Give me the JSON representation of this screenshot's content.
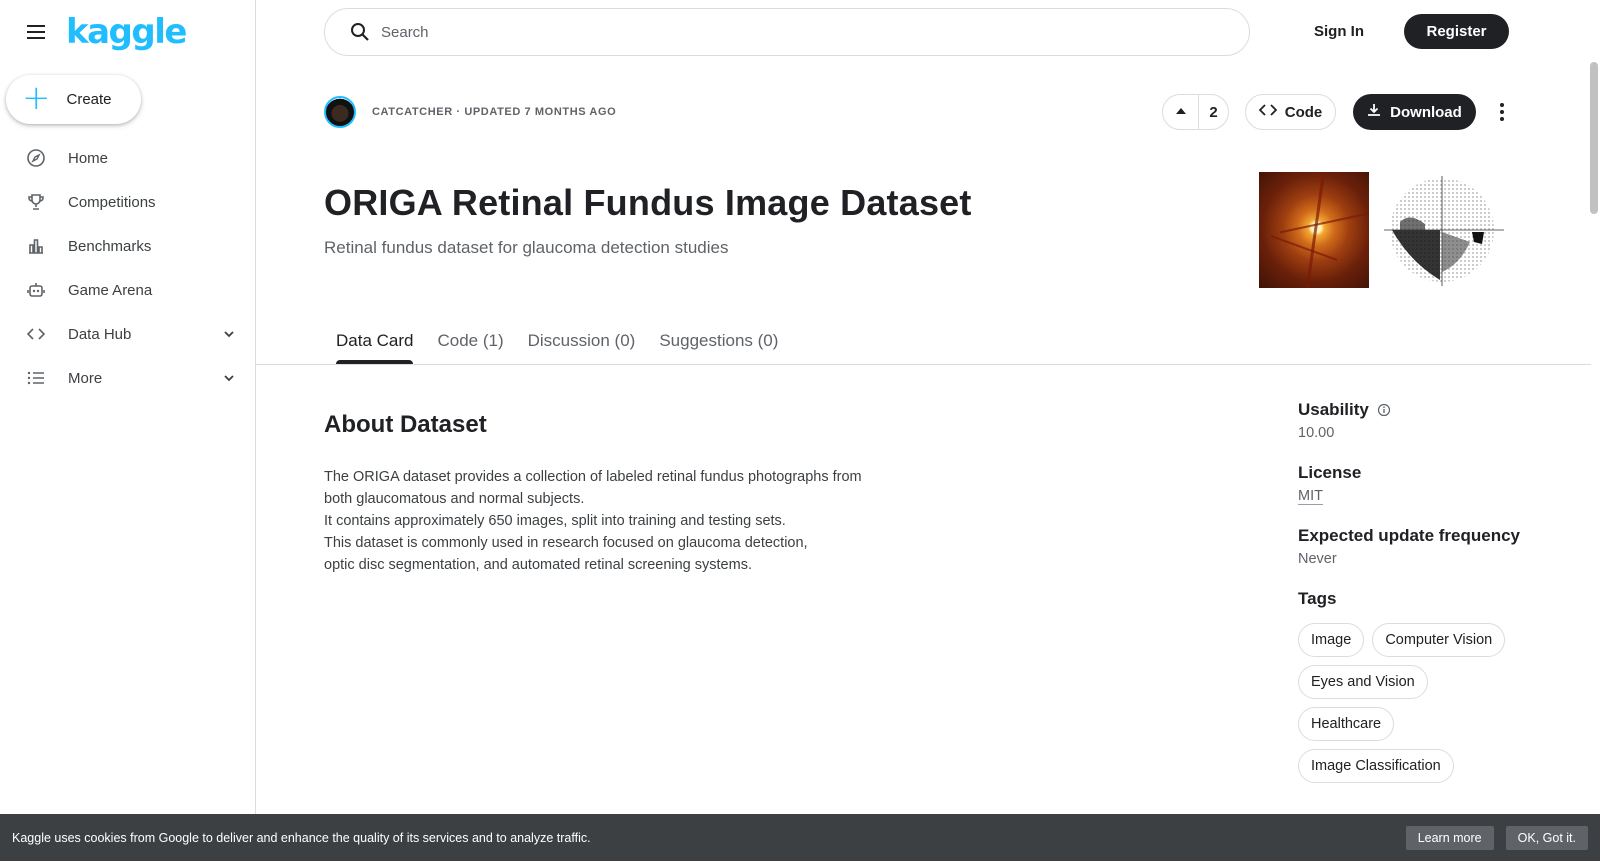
{
  "brand": {
    "logo_text": "kaggle",
    "accent": "#20beff"
  },
  "sidebar": {
    "create_label": "Create",
    "items": [
      {
        "label": "Home",
        "icon": "compass-icon"
      },
      {
        "label": "Competitions",
        "icon": "trophy-icon"
      },
      {
        "label": "Benchmarks",
        "icon": "bar-chart-icon"
      },
      {
        "label": "Game Arena",
        "icon": "robot-icon"
      },
      {
        "label": "Data Hub",
        "icon": "code-icon",
        "expandable": true
      },
      {
        "label": "More",
        "icon": "list-icon",
        "expandable": true
      }
    ]
  },
  "header": {
    "search_placeholder": "Search",
    "signin_label": "Sign In",
    "register_label": "Register"
  },
  "dataset": {
    "owner_line": "CATCATCHER · UPDATED 7 MONTHS AGO",
    "upvotes": "2",
    "code_label": "Code",
    "download_label": "Download",
    "title": "ORIGA Retinal Fundus Image Dataset",
    "subtitle": "Retinal fundus dataset for glaucoma detection studies"
  },
  "tabs": [
    {
      "label": "Data Card",
      "active": true
    },
    {
      "label": "Code (1)"
    },
    {
      "label": "Discussion (0)"
    },
    {
      "label": "Suggestions (0)"
    }
  ],
  "about": {
    "heading": "About Dataset",
    "lines": [
      "The ORIGA dataset provides a collection of labeled retinal fundus photographs from",
      "both glaucomatous and normal subjects.",
      "It contains approximately 650 images, split into training and testing sets.",
      "This dataset is commonly used in research focused on glaucoma detection,",
      "optic disc segmentation, and automated retinal screening systems."
    ]
  },
  "meta": {
    "usability_label": "Usability",
    "usability_value": "10.00",
    "license_label": "License",
    "license_value": "MIT",
    "frequency_label": "Expected update frequency",
    "frequency_value": "Never",
    "tags_label": "Tags",
    "tags": [
      "Image",
      "Computer Vision",
      "Eyes and Vision",
      "Healthcare",
      "Image Classification"
    ]
  },
  "cookie": {
    "text": "Kaggle uses cookies from Google to deliver and enhance the quality of its services and to analyze traffic.",
    "learn_more": "Learn more",
    "ok": "OK, Got it."
  }
}
